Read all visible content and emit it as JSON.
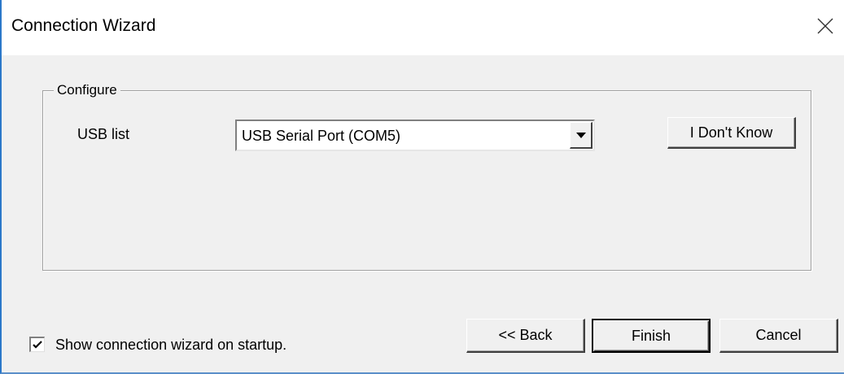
{
  "window": {
    "title": "Connection Wizard",
    "close_icon": "close-icon"
  },
  "configure": {
    "legend": "Configure",
    "usb_list_label": "USB list",
    "usb_selected": "USB Serial Port (COM5)",
    "dropdown_icon": "dropdown-arrow-icon",
    "i_dont_know_label": "I Don't Know"
  },
  "footer": {
    "show_on_startup_label": "Show connection wizard on startup.",
    "show_on_startup_checked": true,
    "back_label": "<< Back",
    "finish_label": "Finish",
    "cancel_label": "Cancel"
  },
  "colors": {
    "dialog_background": "#f0f0f0",
    "title_background": "#ffffff",
    "window_border": "#2b78c9"
  }
}
